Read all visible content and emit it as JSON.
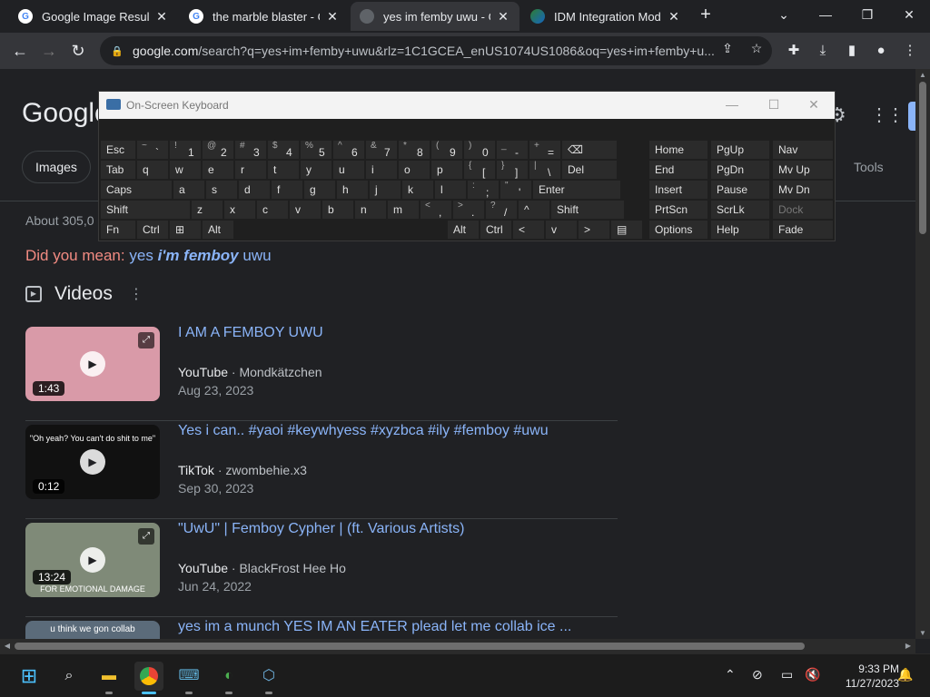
{
  "tabs": [
    {
      "title": "Google Image Result",
      "favicon": "google-icon",
      "active": false
    },
    {
      "title": "the marble blaster - Go",
      "favicon": "google-icon",
      "active": false
    },
    {
      "title": "yes im femby uwu - Go",
      "favicon": "loading-spinner-icon",
      "active": true
    },
    {
      "title": "IDM Integration Modul",
      "favicon": "idm-icon",
      "active": false
    }
  ],
  "toolbar": {
    "url_host": "google.com",
    "url_rest": "/search?q=yes+im+femby+uwu&rlz=1C1GCEA_enUS1074US1086&oq=yes+im+femby+u..."
  },
  "page": {
    "logo": "Google",
    "chip_images": "Images",
    "tools": "Tools",
    "stats": "About 305,0",
    "didyou_label": "Did you mean:",
    "didyou_pre": "yes",
    "didyou_bold": "i'm femboy",
    "didyou_post": "uwu",
    "videos_heading": "Videos"
  },
  "videos": [
    {
      "title": "I AM A FEMBOY UWU",
      "platform": "YouTube",
      "channel": "Mondkätzchen",
      "date": "Aug 23, 2023",
      "duration": "1:43",
      "thumb_bg": "#d99aa8",
      "caption": ""
    },
    {
      "title": "Yes i can.. #yaoi #keywhyess #xyzbca #ily #femboy #uwu",
      "platform": "TikTok",
      "channel": "zwombehie.x3",
      "date": "Sep 30, 2023",
      "duration": "0:12",
      "thumb_bg": "#111111",
      "caption": "\"Oh yeah? You can't do shit to me\""
    },
    {
      "title": "\"UwU\" | Femboy Cypher | (ft. Various Artists)",
      "platform": "YouTube",
      "channel": "BlackFrost Hee Ho",
      "date": "Jun 24, 2022",
      "duration": "13:24",
      "thumb_bg": "#7f8a78",
      "caption": "FOR EMOTIONAL DAMAGE"
    },
    {
      "title": "yes im a munch YES IM AN EATER plead let me collab ice ...",
      "platform": "",
      "channel": "",
      "date": "",
      "duration": "",
      "thumb_bg": "#5b6b7a",
      "caption": "u think we gon collab"
    }
  ],
  "osk": {
    "title": "On-Screen Keyboard",
    "rows": [
      [
        [
          "Esc",
          ""
        ],
        [
          "`",
          "~"
        ],
        [
          "1",
          "!"
        ],
        [
          "2",
          "@"
        ],
        [
          "3",
          "#"
        ],
        [
          "4",
          "$"
        ],
        [
          "5",
          "%"
        ],
        [
          "6",
          "^"
        ],
        [
          "7",
          "&"
        ],
        [
          "8",
          "*"
        ],
        [
          "9",
          "("
        ],
        [
          "0",
          ")"
        ],
        [
          "-",
          "_"
        ],
        [
          "=",
          "+"
        ],
        [
          "⌫",
          ""
        ]
      ],
      [
        [
          "Tab",
          ""
        ],
        [
          "q",
          ""
        ],
        [
          "w",
          ""
        ],
        [
          "e",
          ""
        ],
        [
          "r",
          ""
        ],
        [
          "t",
          ""
        ],
        [
          "y",
          ""
        ],
        [
          "u",
          ""
        ],
        [
          "i",
          ""
        ],
        [
          "o",
          ""
        ],
        [
          "p",
          ""
        ],
        [
          "[",
          "{"
        ],
        [
          "]",
          "}"
        ],
        [
          "\\",
          "|"
        ],
        [
          "Del",
          ""
        ]
      ],
      [
        [
          "Caps",
          ""
        ],
        [
          "a",
          ""
        ],
        [
          "s",
          ""
        ],
        [
          "d",
          ""
        ],
        [
          "f",
          ""
        ],
        [
          "g",
          ""
        ],
        [
          "h",
          ""
        ],
        [
          "j",
          ""
        ],
        [
          "k",
          ""
        ],
        [
          "l",
          ""
        ],
        [
          ";",
          ":"
        ],
        [
          "'",
          "\""
        ],
        [
          "Enter",
          ""
        ]
      ],
      [
        [
          "Shift",
          ""
        ],
        [
          "z",
          ""
        ],
        [
          "x",
          ""
        ],
        [
          "c",
          ""
        ],
        [
          "v",
          ""
        ],
        [
          "b",
          ""
        ],
        [
          "n",
          ""
        ],
        [
          "m",
          ""
        ],
        [
          ",",
          "<"
        ],
        [
          ".",
          ">"
        ],
        [
          "/",
          "?"
        ],
        [
          "^",
          ""
        ],
        [
          "Shift",
          ""
        ]
      ],
      [
        [
          "Fn",
          ""
        ],
        [
          "Ctrl",
          ""
        ],
        [
          "⊞",
          ""
        ],
        [
          "Alt",
          ""
        ],
        [
          "",
          ""
        ],
        [
          "Alt",
          ""
        ],
        [
          "Ctrl",
          ""
        ],
        [
          "<",
          ""
        ],
        [
          "v",
          ""
        ],
        [
          ">",
          ""
        ],
        [
          "▤",
          ""
        ]
      ]
    ],
    "side": [
      [
        "Home",
        "PgUp",
        "Nav"
      ],
      [
        "End",
        "PgDn",
        "Mv Up"
      ],
      [
        "Insert",
        "Pause",
        "Mv Dn"
      ],
      [
        "PrtScn",
        "ScrLk",
        "Dock"
      ],
      [
        "Options",
        "Help",
        "Fade"
      ]
    ]
  },
  "taskbar": {
    "time": "9:33 PM",
    "date": "11/27/2023"
  }
}
